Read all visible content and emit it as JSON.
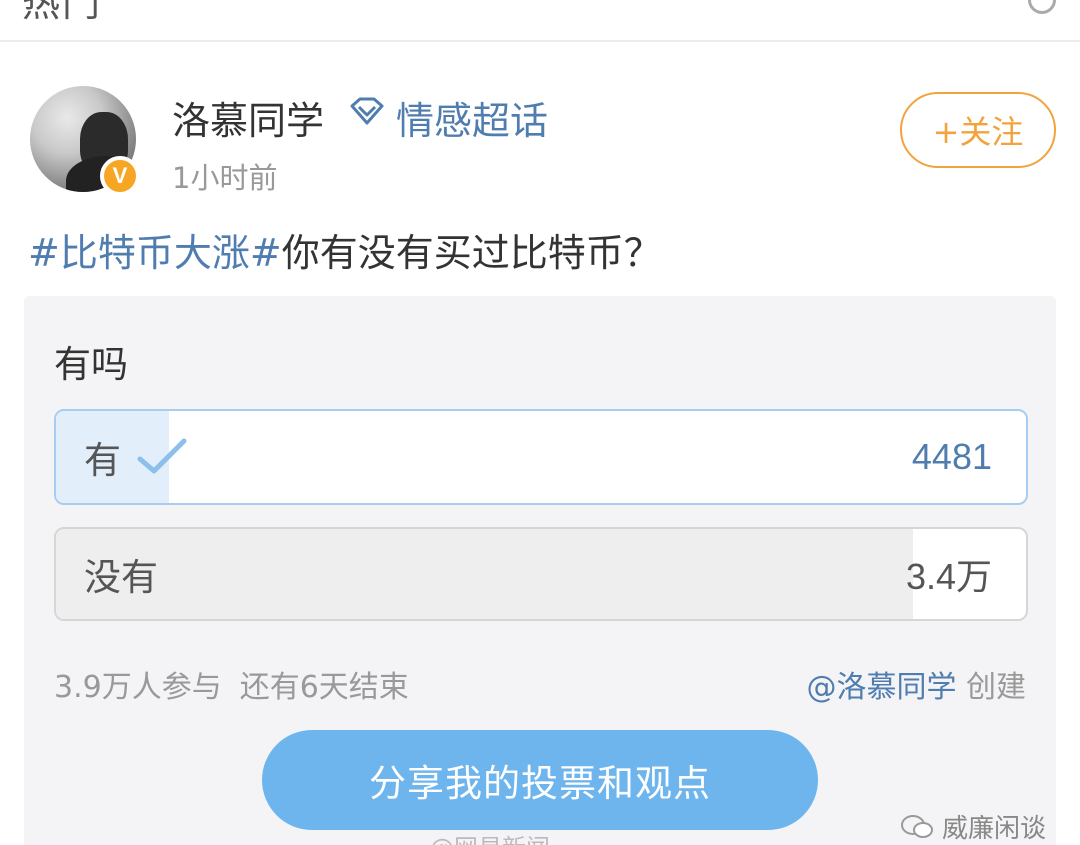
{
  "topbar": {
    "tab_label": "热门"
  },
  "post": {
    "username": "洛慕同学",
    "supertopic": "情感超话",
    "time": "1小时前",
    "follow_label": "+关注",
    "verified_badge": "V",
    "hashtag": "#比特币大涨#",
    "text": "你有没有买过比特币？"
  },
  "poll": {
    "title": "有吗",
    "options": [
      {
        "label": "有",
        "count": "4481",
        "voted": true,
        "share": 0.116
      },
      {
        "label": "没有",
        "count": "3.4万",
        "voted": false,
        "share": 0.884
      }
    ],
    "participants": "3.9万人参与",
    "remaining": "还有6天结束",
    "creator_mention": "@洛慕同学",
    "creator_suffix": "创建",
    "share_button": "分享我的投票和观点"
  },
  "watermark": {
    "label": "威廉闲谈",
    "bottom_text": "@网易新闻"
  },
  "colors": {
    "link_blue": "#507daf",
    "follow_orange": "#f3a33c",
    "share_button_blue": "#6eb5ee",
    "verified_orange": "#f6a623"
  },
  "icons": {
    "supertopic": "diamond-icon",
    "voted": "check-icon",
    "verified": "verified-badge-icon",
    "watermark": "wechat-icon"
  }
}
